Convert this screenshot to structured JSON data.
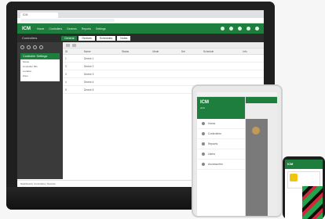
{
  "desktop": {
    "browser_tab": "ICM",
    "app_logo": "ICM",
    "nav": [
      "Home",
      "Controllers",
      "Devices",
      "Reports",
      "Settings"
    ],
    "sub_title": "Controllers",
    "sub_tabs": [
      "General",
      "Devices",
      "Schedules",
      "Notes"
    ],
    "settings_card": {
      "title": "Controller Settings",
      "lines": [
        "Name",
        "Controller 001",
        "Location",
        "Zone"
      ]
    },
    "table_headers": [
      "ID",
      "Name",
      "Status",
      "Mode",
      "Set",
      "Schedule",
      "Info"
    ],
    "rows": [
      [
        "1",
        "Device 1",
        "",
        "",
        "",
        "",
        ""
      ],
      [
        "2",
        "Device 2",
        "",
        "",
        "",
        "",
        ""
      ],
      [
        "3",
        "Device 3",
        "",
        "",
        "",
        "",
        ""
      ],
      [
        "4",
        "Device 4",
        "",
        "",
        "",
        "",
        ""
      ],
      [
        "5",
        "Device 5",
        "",
        "",
        "",
        "",
        ""
      ]
    ],
    "status_text": "Dashboard | Controllers | Devices"
  },
  "tablet": {
    "logo": "ICM",
    "version": "v2.0",
    "menu_items": [
      "Home",
      "Controllers",
      "Reports",
      "Users",
      "Accessories"
    ]
  },
  "phone": {
    "header": "ICM"
  },
  "colors": {
    "brand": "#1e7e3e",
    "dark": "#2b2b2b"
  }
}
